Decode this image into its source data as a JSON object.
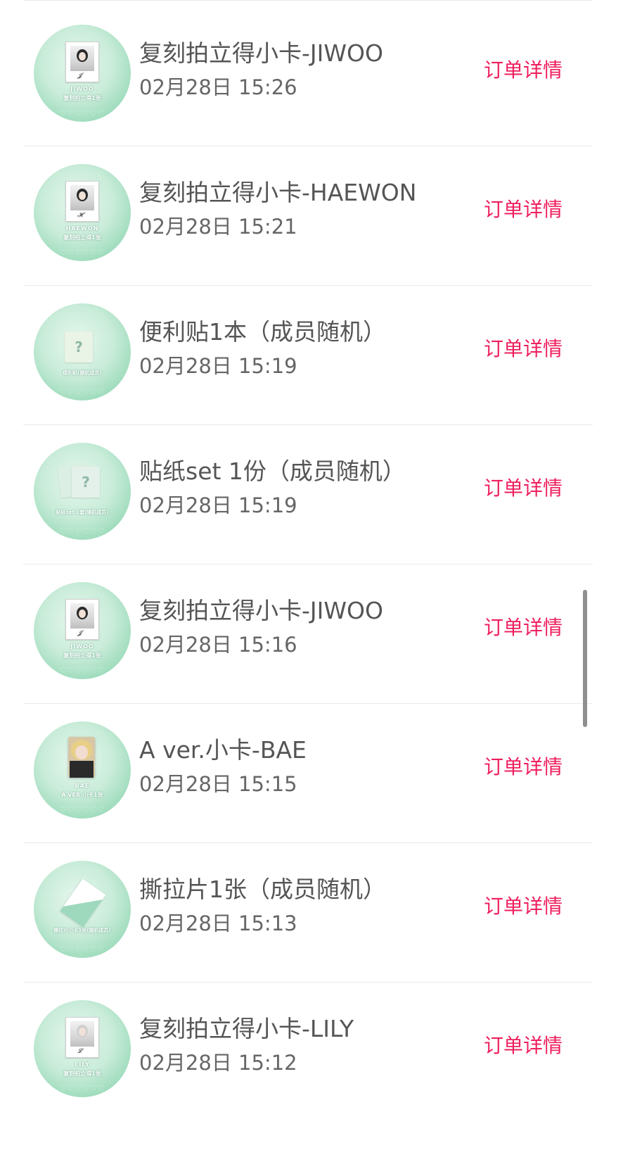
{
  "accent_color": "#ef1f5e",
  "orders": [
    {
      "title": "复刻拍立得小卡-JIWOO",
      "time": "02月28日 15:26",
      "action": "订单详情",
      "thumb": {
        "kind": "polaroid",
        "caption_line1": "JIWOO",
        "caption_line2": "复刻拍立得1张"
      }
    },
    {
      "title": "复刻拍立得小卡-HAEWON",
      "time": "02月28日 15:21",
      "action": "订单详情",
      "thumb": {
        "kind": "polaroid",
        "caption_line1": "HAEWON",
        "caption_line2": "复刻拍立得1张"
      }
    },
    {
      "title": "便利贴1本（成员随机）",
      "time": "02月28日 15:19",
      "action": "订单详情",
      "thumb": {
        "kind": "question-card",
        "caption_line1": "便利贴(随机成员)"
      }
    },
    {
      "title": "贴纸set 1份（成员随机）",
      "time": "02月28日 15:19",
      "action": "订单详情",
      "thumb": {
        "kind": "question-cards",
        "caption_line1": "贴纸set 1套(随机成员)"
      }
    },
    {
      "title": "复刻拍立得小卡-JIWOO",
      "time": "02月28日 15:16",
      "action": "订单详情",
      "thumb": {
        "kind": "polaroid",
        "caption_line1": "JIWOO",
        "caption_line2": "复刻拍立得1张"
      }
    },
    {
      "title": "A ver.小卡-BAE",
      "time": "02月28日 15:15",
      "action": "订单详情",
      "thumb": {
        "kind": "photocard",
        "caption_line1": "BAE",
        "caption_line2": "A VER.小卡1张"
      }
    },
    {
      "title": "撕拉片1张（成员随机）",
      "time": "02月28日 15:13",
      "action": "订单详情",
      "thumb": {
        "kind": "scratch",
        "caption_line1": "撕拉片小卡1张(随机成员)"
      }
    },
    {
      "title": "复刻拍立得小卡-LILY",
      "time": "02月28日 15:12",
      "action": "订单详情",
      "thumb": {
        "kind": "polaroid",
        "caption_line1": "LILY",
        "caption_line2": "复刻拍立得1张"
      }
    }
  ]
}
